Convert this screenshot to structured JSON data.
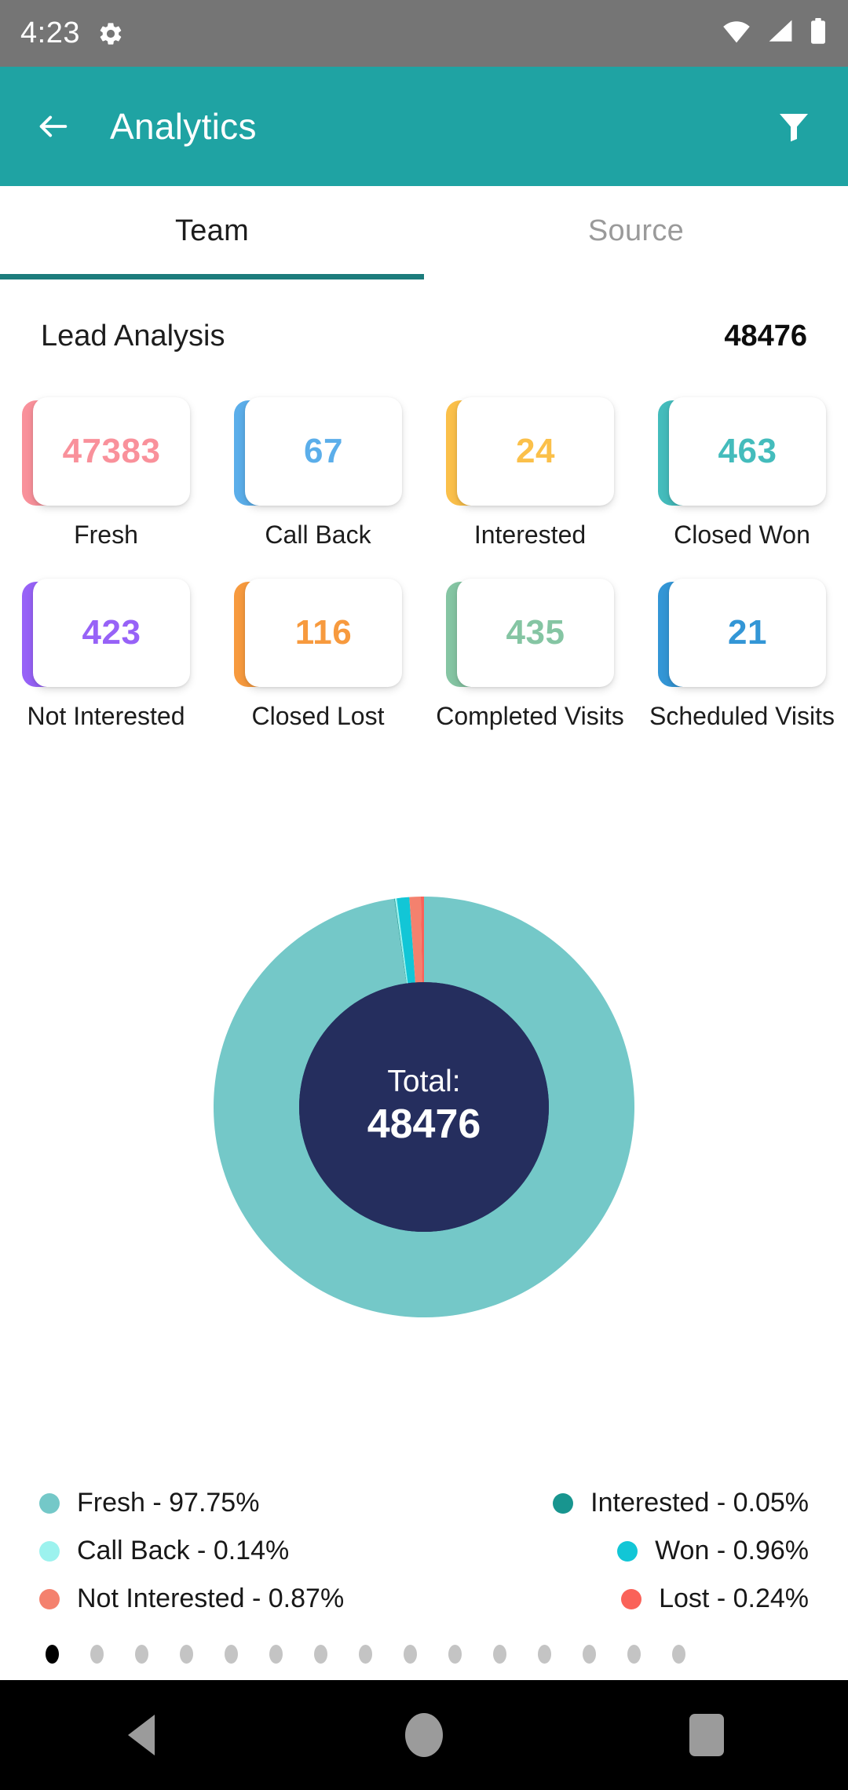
{
  "status_bar": {
    "time": "4:23",
    "gear_icon": "gear-icon",
    "wifi_icon": "wifi-icon",
    "signal_icon": "cellular-signal-icon",
    "battery_icon": "battery-icon"
  },
  "app_bar": {
    "back_icon": "arrow-left-icon",
    "title": "Analytics",
    "filter_icon": "filter-funnel-icon",
    "background_color": "#1fa3a3"
  },
  "tabs": {
    "items": [
      {
        "label": "Team",
        "active": true
      },
      {
        "label": "Source",
        "active": false
      }
    ],
    "indicator_color": "#1c7c7c"
  },
  "section": {
    "title": "Lead Analysis",
    "total": "48476"
  },
  "stat_cards": [
    {
      "value": "47383",
      "label": "Fresh",
      "color": "#F9919B"
    },
    {
      "value": "67",
      "label": "Call Back",
      "color": "#5BAEEA"
    },
    {
      "value": "24",
      "label": "Interested",
      "color": "#FBC04A"
    },
    {
      "value": "463",
      "label": "Closed Won",
      "color": "#44BCBC"
    },
    {
      "value": "423",
      "label": "Not Interested",
      "color": "#9762F7"
    },
    {
      "value": "116",
      "label": "Closed Lost",
      "color": "#F79A3E"
    },
    {
      "value": "435",
      "label": "Completed Visits",
      "color": "#85C5A3"
    },
    {
      "value": "21",
      "label": "Scheduled Visits",
      "color": "#3396D6"
    }
  ],
  "donut": {
    "center_label": "Total:",
    "center_value": "48476",
    "center_color": "#252E5E"
  },
  "chart_data": {
    "type": "pie",
    "title": "Lead Analysis",
    "total": 48476,
    "legend_position": "bottom",
    "labels": [
      "Fresh",
      "Interested",
      "Call Back",
      "Won",
      "Not Interested",
      "Lost"
    ],
    "values": [
      97.75,
      0.05,
      0.14,
      0.96,
      0.87,
      0.24
    ],
    "counts": [
      47383,
      24,
      67,
      463,
      423,
      116
    ],
    "unit": "%",
    "colors": [
      "#74C8C8",
      "#18958F",
      "#9CF2EE",
      "#12C6D6",
      "#F4816E",
      "#FA6259"
    ]
  },
  "legend": {
    "left": [
      {
        "text": "Fresh - 97.75%",
        "color": "#74C8C8"
      },
      {
        "text": "Call Back - 0.14%",
        "color": "#9CF2EE"
      },
      {
        "text": "Not Interested - 0.87%",
        "color": "#F4816E"
      }
    ],
    "right": [
      {
        "text": "Interested - 0.05%",
        "color": "#18958F"
      },
      {
        "text": "Won - 0.96%",
        "color": "#12C6D6"
      },
      {
        "text": "Lost - 0.24%",
        "color": "#FA6259"
      }
    ]
  },
  "page_dots": {
    "count": 15,
    "active_index": 0
  },
  "nav_bar": {
    "back_icon": "nav-back-triangle-icon",
    "home_icon": "nav-home-circle-icon",
    "recents_icon": "nav-recents-square-icon"
  }
}
